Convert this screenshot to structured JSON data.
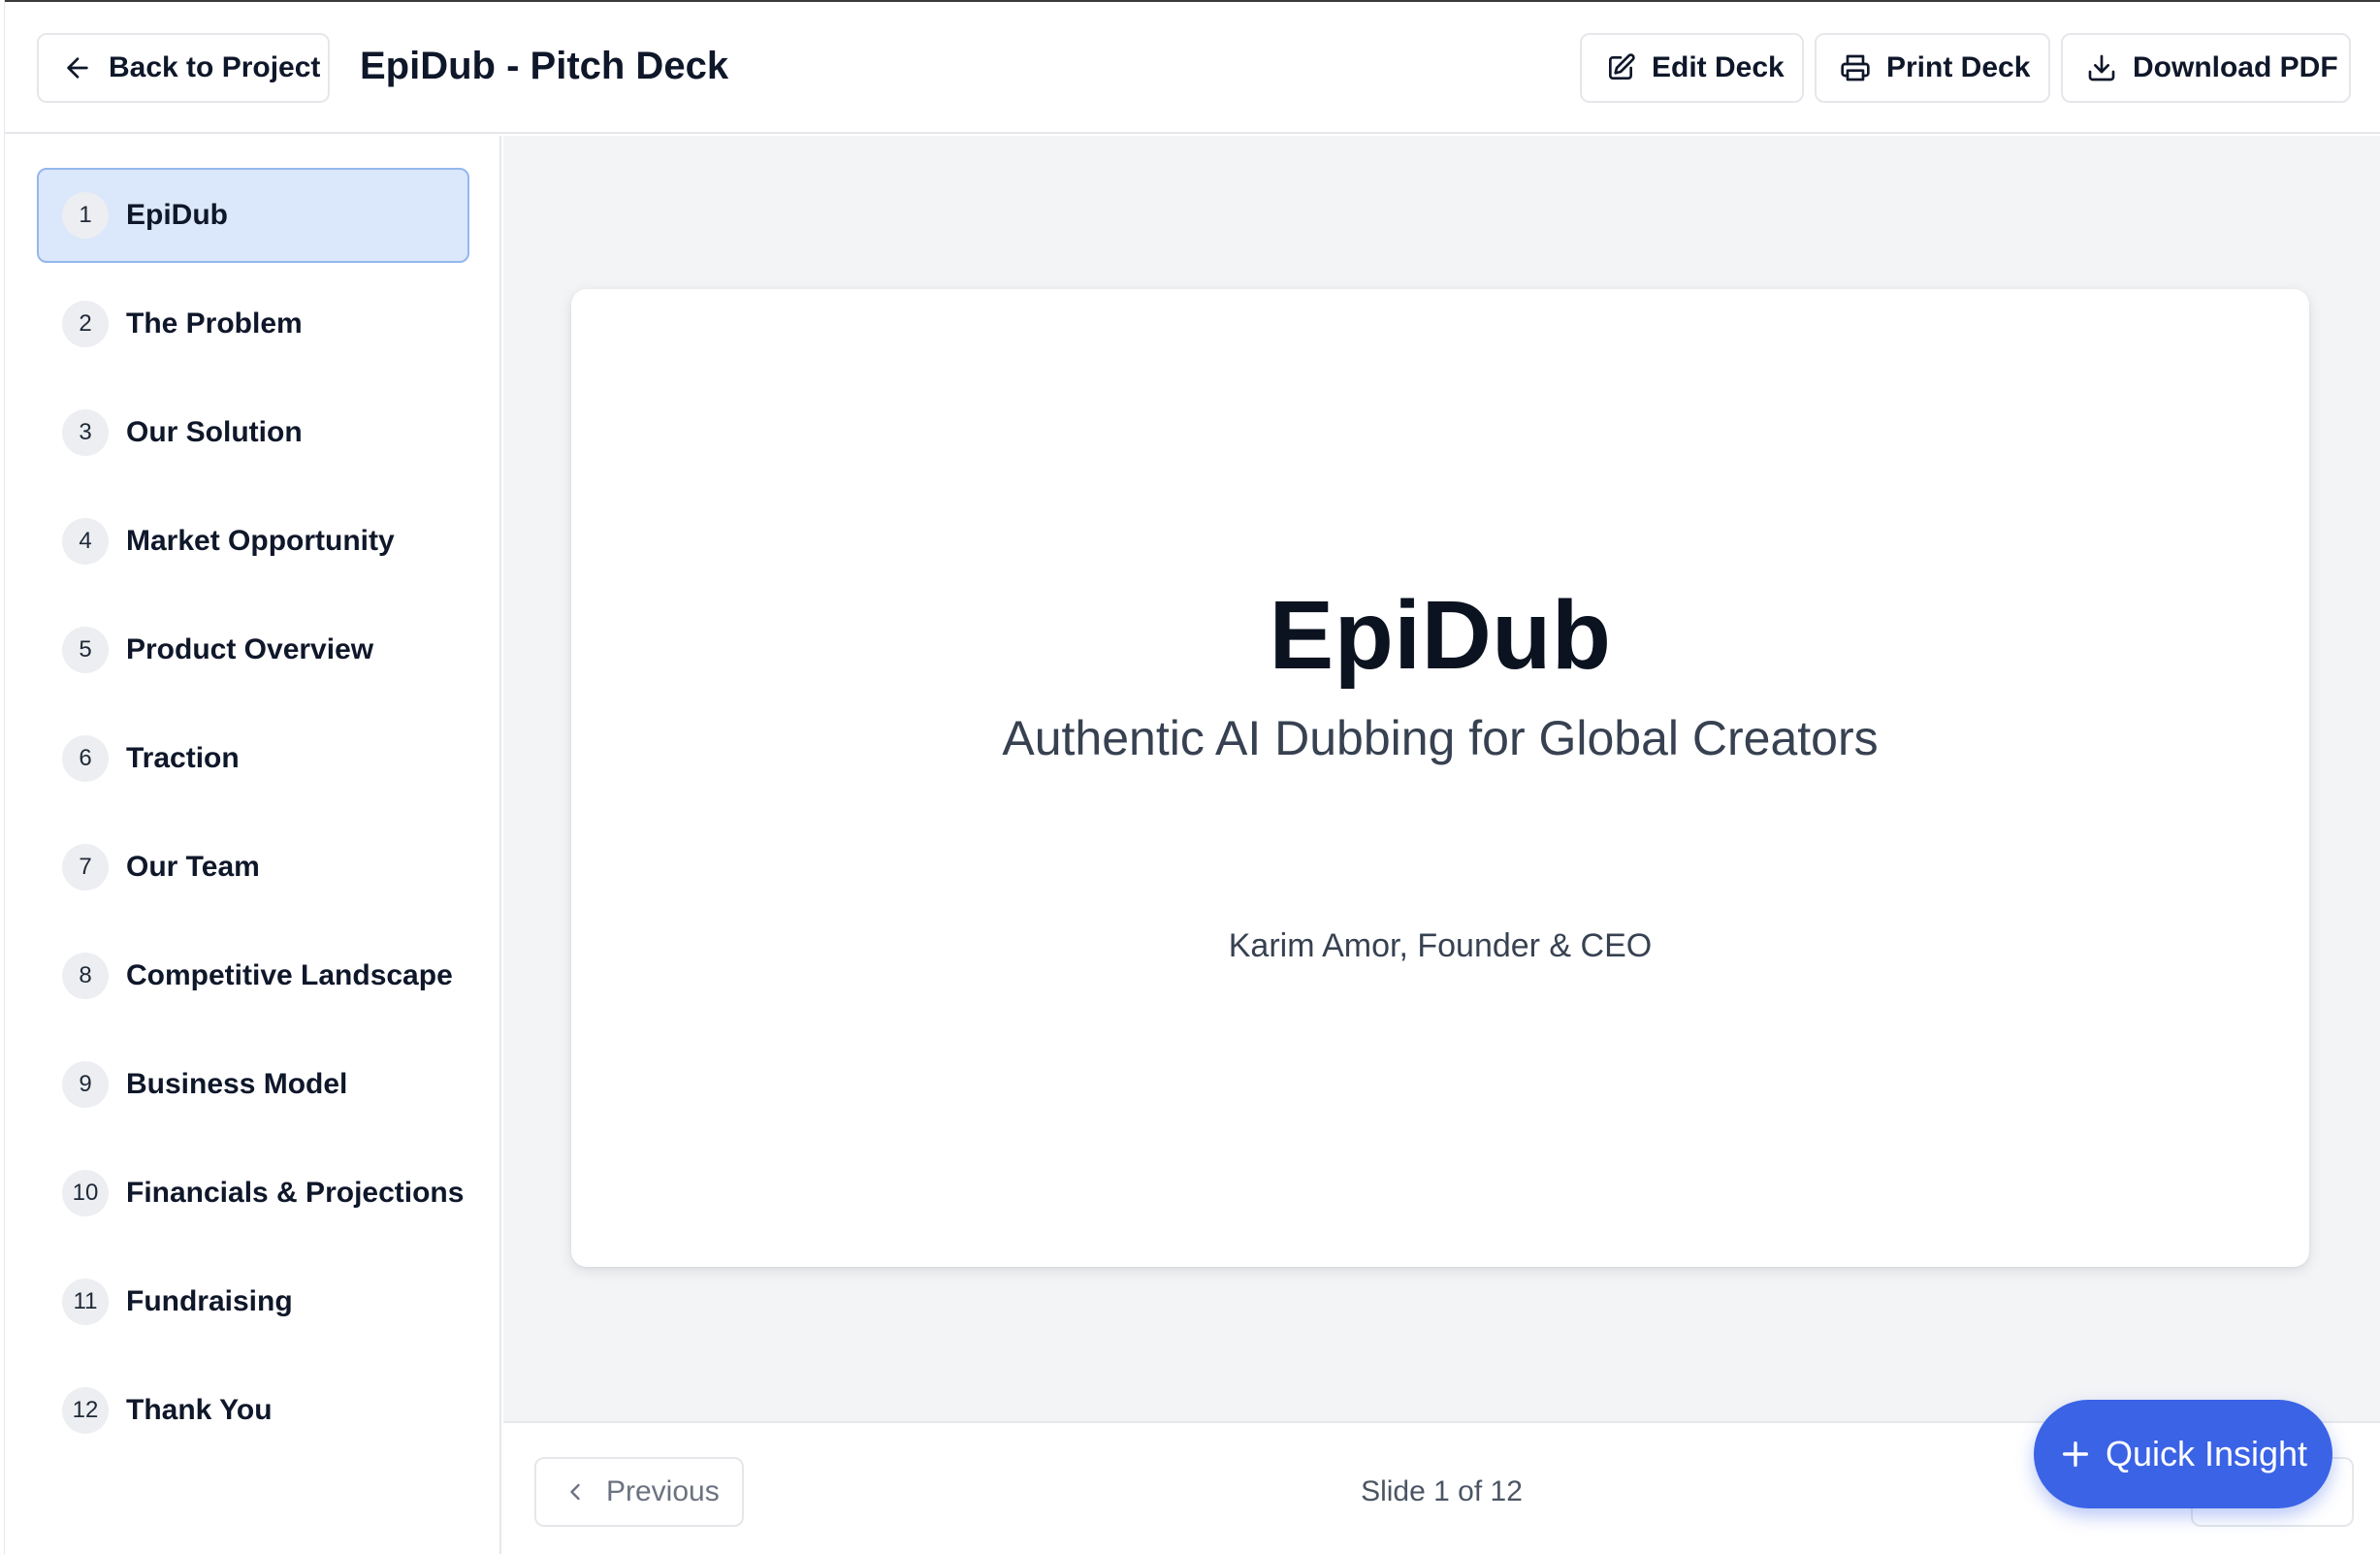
{
  "header": {
    "back_label": "Back to Project",
    "title": "EpiDub - Pitch Deck",
    "edit_label": "Edit Deck",
    "print_label": "Print Deck",
    "download_label": "Download PDF"
  },
  "sidebar": {
    "items": [
      {
        "num": "1",
        "label": "EpiDub",
        "active": true
      },
      {
        "num": "2",
        "label": "The Problem"
      },
      {
        "num": "3",
        "label": "Our Solution"
      },
      {
        "num": "4",
        "label": "Market Opportunity"
      },
      {
        "num": "5",
        "label": "Product Overview"
      },
      {
        "num": "6",
        "label": "Traction"
      },
      {
        "num": "7",
        "label": "Our Team"
      },
      {
        "num": "8",
        "label": "Competitive Landscape"
      },
      {
        "num": "9",
        "label": "Business Model"
      },
      {
        "num": "10",
        "label": "Financials & Projections"
      },
      {
        "num": "11",
        "label": "Fundraising"
      },
      {
        "num": "12",
        "label": "Thank You"
      }
    ]
  },
  "slide": {
    "title": "EpiDub",
    "subtitle": "Authentic AI Dubbing for Global Creators",
    "author": "Karim Amor, Founder & CEO"
  },
  "footer": {
    "previous_label": "Previous",
    "counter": "Slide 1 of 12"
  },
  "fab": {
    "label": "Quick Insight"
  },
  "colors": {
    "accent": "#3b63e6",
    "active_item_bg": "#dbe7fa",
    "active_item_border": "#93b7ee",
    "main_bg": "#f3f4f6"
  },
  "icons": {
    "back": "arrow-left-icon",
    "edit": "pencil-square-icon",
    "print": "printer-icon",
    "download": "download-icon",
    "previous": "chevron-left-icon",
    "fab": "plus-icon"
  }
}
